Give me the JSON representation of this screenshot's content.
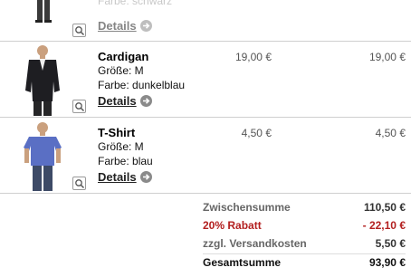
{
  "top_item": {
    "name_partial": "Farbe: schwarz",
    "details_label": "Details",
    "image_alt": "trousers",
    "zoom_icon": "zoom-icon",
    "arrow_icon": "arrow-right-icon"
  },
  "items": [
    {
      "name": "Cardigan",
      "size": "Größe: M",
      "color": "Farbe: dunkelblau",
      "details_label": "Details",
      "unit_price": "19,00 €",
      "total_price": "19,00 €",
      "image": "cardigan-photo"
    },
    {
      "name": "T-Shirt",
      "size": "Größe: M",
      "color": "Farbe: blau",
      "details_label": "Details",
      "unit_price": "4,50 €",
      "total_price": "4,50 €",
      "image": "tshirt-photo"
    }
  ],
  "summary": {
    "subtotal_label": "Zwischensumme",
    "subtotal_value": "110,50 €",
    "discount_label": "20% Rabatt",
    "discount_value": "- 22,10 €",
    "shipping_label": "zzgl. Versandkosten",
    "shipping_value": "5,50 €",
    "total_label": "Gesamtsumme",
    "total_value": "93,90 €"
  },
  "colors": {
    "discount": "#b32020",
    "rule": "#cfcfcf",
    "arrow_badge": "#8a8a8a"
  }
}
